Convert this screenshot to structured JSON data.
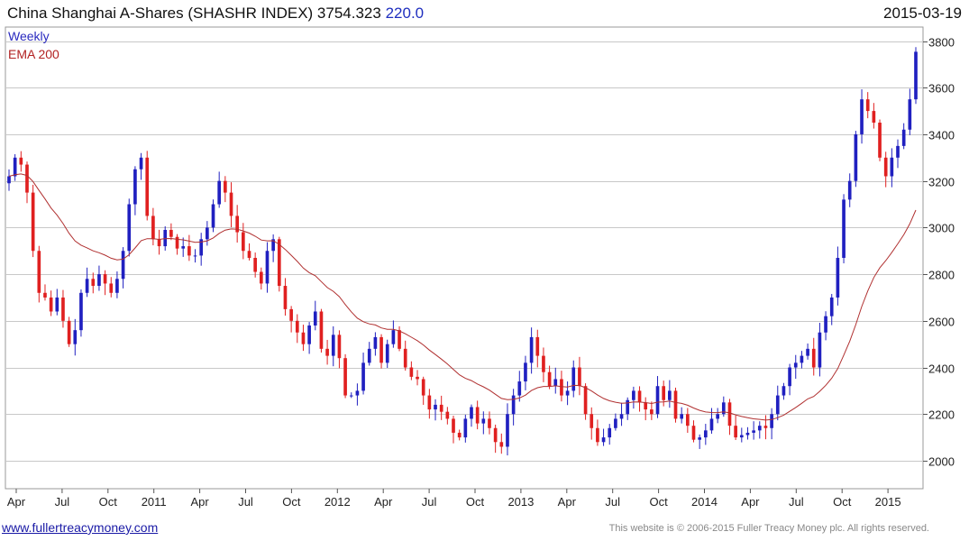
{
  "header": {
    "title": "China Shanghai A-Shares (SHASHR INDEX) 3754.323",
    "change": "220.0",
    "date": "2015-03-19"
  },
  "legend": {
    "series1": "Weekly",
    "series2": "EMA 200"
  },
  "footer": {
    "website": "www.fullertreacymoney.com",
    "copyright": "This website is © 2006-2015 Fuller Treacy Money plc. All rights reserved."
  },
  "colors": {
    "up": "#2020c0",
    "down": "#e02020",
    "ema": "#b03030",
    "grid": "#c8c8c8"
  },
  "chart_data": {
    "type": "candlestick",
    "title": "China Shanghai A-Shares (SHASHR INDEX) 3754.323 220.0",
    "x_tick_labels": [
      "Apr",
      "Jul",
      "Oct",
      "2011",
      "Apr",
      "Jul",
      "Oct",
      "2012",
      "Apr",
      "Jul",
      "Oct",
      "2013",
      "Apr",
      "Jul",
      "Oct",
      "2014",
      "Apr",
      "Jul",
      "Oct",
      "2015"
    ],
    "y_ticks": [
      2000,
      2200,
      2400,
      2600,
      2800,
      3000,
      3200,
      3400,
      3600,
      3800
    ],
    "ylim": [
      1880,
      3860
    ],
    "grid": true,
    "weekly_close": [
      3220,
      3300,
      3270,
      3150,
      2900,
      2720,
      2700,
      2640,
      2700,
      2600,
      2500,
      2560,
      2720,
      2780,
      2750,
      2800,
      2760,
      2720,
      2780,
      2900,
      3100,
      3250,
      3300,
      3050,
      2950,
      2920,
      2990,
      2960,
      2910,
      2920,
      2880,
      2880,
      2950,
      3000,
      3100,
      3200,
      3150,
      3050,
      2980,
      2900,
      2870,
      2810,
      2760,
      2900,
      2950,
      2750,
      2650,
      2600,
      2550,
      2500,
      2580,
      2640,
      2480,
      2450,
      2540,
      2440,
      2280,
      2280,
      2300,
      2420,
      2480,
      2530,
      2420,
      2500,
      2560,
      2480,
      2400,
      2360,
      2350,
      2280,
      2220,
      2240,
      2210,
      2180,
      2120,
      2100,
      2180,
      2230,
      2160,
      2180,
      2140,
      2080,
      2060,
      2200,
      2280,
      2340,
      2420,
      2530,
      2450,
      2380,
      2320,
      2350,
      2280,
      2300,
      2400,
      2320,
      2200,
      2140,
      2080,
      2100,
      2140,
      2180,
      2200,
      2260,
      2300,
      2250,
      2220,
      2200,
      2320,
      2260,
      2300,
      2180,
      2200,
      2150,
      2090,
      2100,
      2130,
      2180,
      2200,
      2250,
      2150,
      2100,
      2110,
      2120,
      2130,
      2150,
      2140,
      2200,
      2280,
      2320,
      2400,
      2420,
      2450,
      2480,
      2400,
      2550,
      2620,
      2700,
      2870,
      3120,
      3200,
      3400,
      3550,
      3500,
      3450,
      3300,
      3220,
      3300,
      3350,
      3420,
      3550,
      3754
    ]
  }
}
